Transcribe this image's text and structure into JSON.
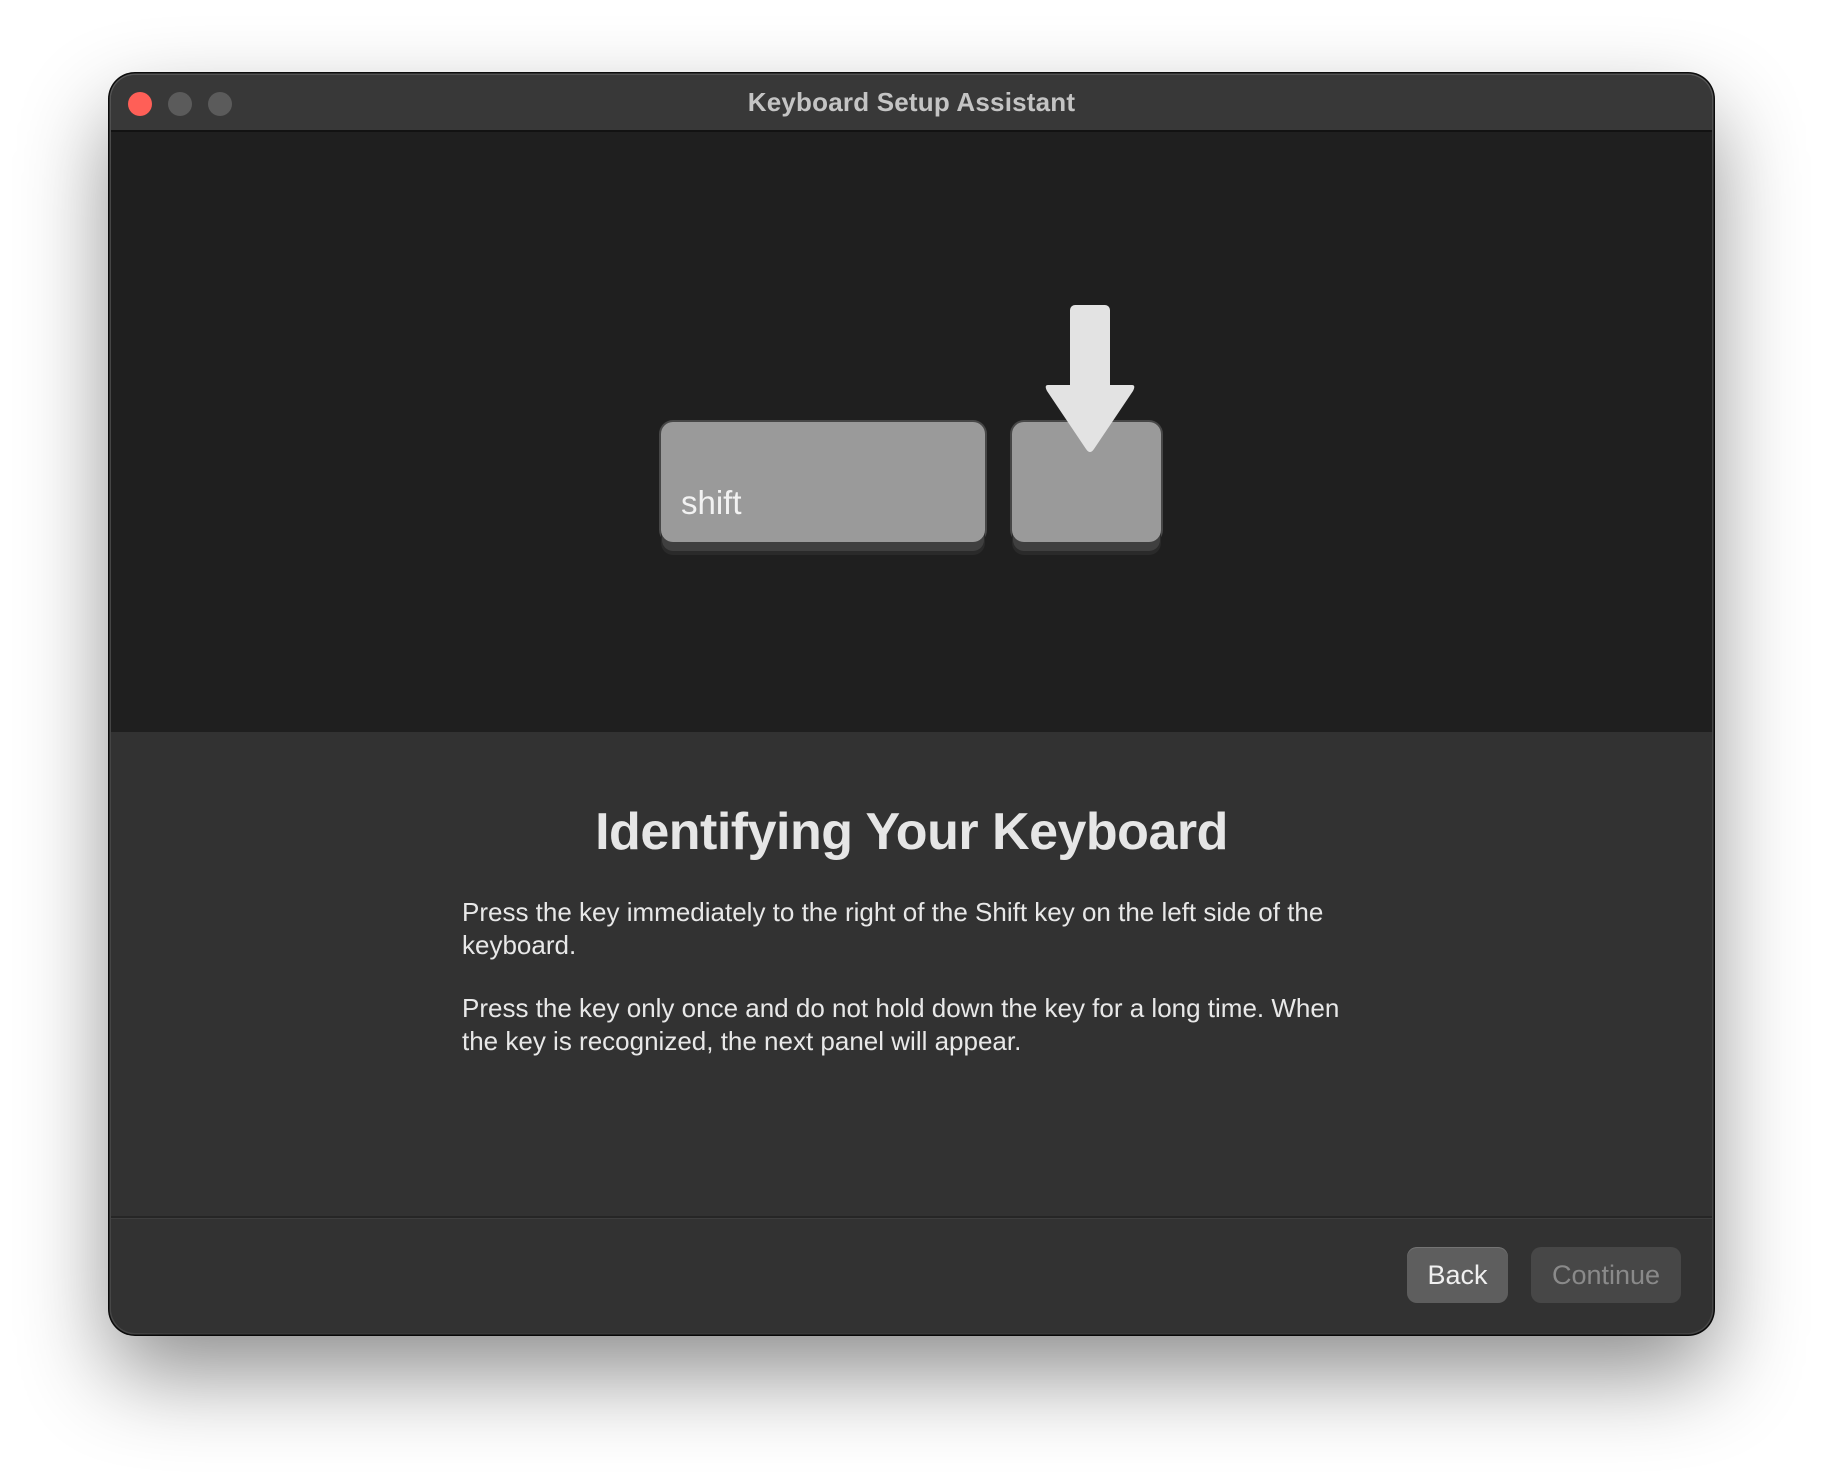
{
  "window": {
    "title": "Keyboard Setup Assistant"
  },
  "illustration": {
    "shift_key_label": "shift",
    "arrow_icon": "down-arrow-icon"
  },
  "content": {
    "heading": "Identifying Your Keyboard",
    "instruction_1": "Press the key immediately to the right of the Shift key on the left side of the keyboard.",
    "instruction_2": "Press the key only once and do not hold down the key for a long time. When the key is recognized, the next panel will appear."
  },
  "footer": {
    "back_label": "Back",
    "continue_label": "Continue",
    "continue_enabled": false
  },
  "colors": {
    "close": "#ff5f57",
    "window_bg": "#323232",
    "illustration_bg": "#1f1f1f",
    "key": "#9a9a9a"
  }
}
